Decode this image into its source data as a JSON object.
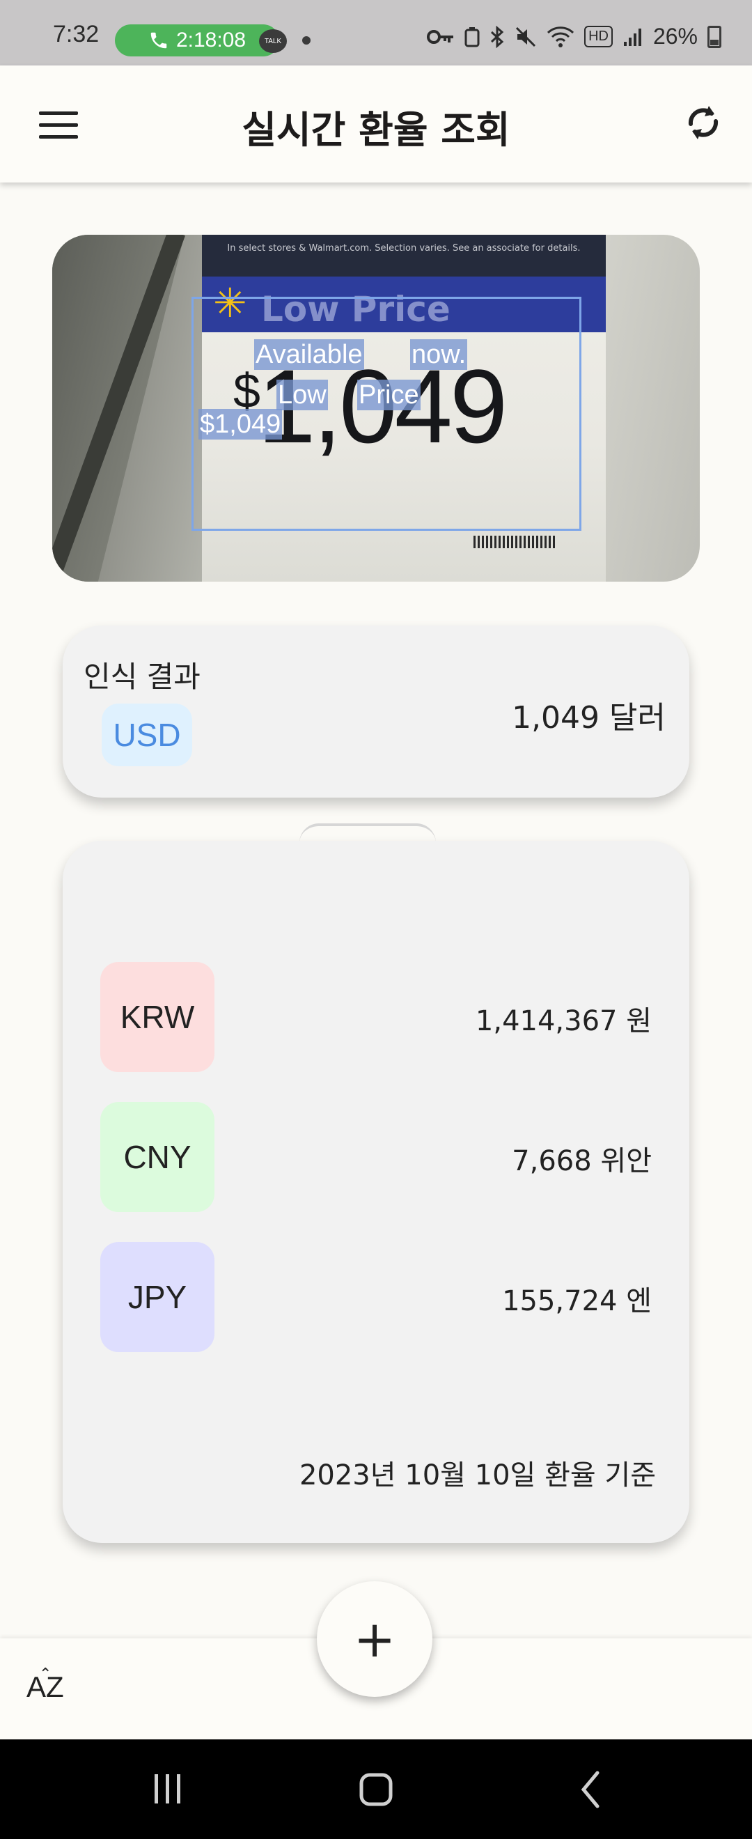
{
  "status_bar": {
    "time": "7:32",
    "call_timer": "2:18:08",
    "talk_label": "TALK",
    "hd_label": "HD",
    "battery": "26%",
    "call_color": "#4db45a"
  },
  "app_bar": {
    "title": "실시간 환율 조회",
    "menu_icon": "hamburger-menu-icon",
    "refresh_icon": "refresh-icon"
  },
  "photo": {
    "sign_top_text": "In select stores & Walmart.com. Selection varies. See an associate for details.",
    "sign_header": "Low Price",
    "sign_price_symbol": "$",
    "sign_price": "1,049",
    "ocr_words": {
      "available": "Available",
      "now": "now.",
      "low": "Low",
      "price": "Price",
      "amount": "$1,049"
    },
    "ocr_box_color": "#7ea6e8"
  },
  "result": {
    "title": "인식 결과",
    "currency": "USD",
    "amount": "1,049 달러",
    "chip_color": "#dff1fe"
  },
  "rates": {
    "rows": [
      {
        "code": "KRW",
        "value": "1,414,367 원",
        "color": "#fddede"
      },
      {
        "code": "CNY",
        "value": "7,668 위안",
        "color": "#dcfbdd"
      },
      {
        "code": "JPY",
        "value": "155,724 엔",
        "color": "#dedefe"
      }
    ],
    "footer": "2023년 10월 10일 환율 기준"
  },
  "bottom": {
    "fab_label": "+",
    "sort_label": "AZ"
  },
  "nav": {
    "recent_icon": "recent-apps-icon",
    "home_icon": "home-icon",
    "back_icon": "back-icon"
  }
}
